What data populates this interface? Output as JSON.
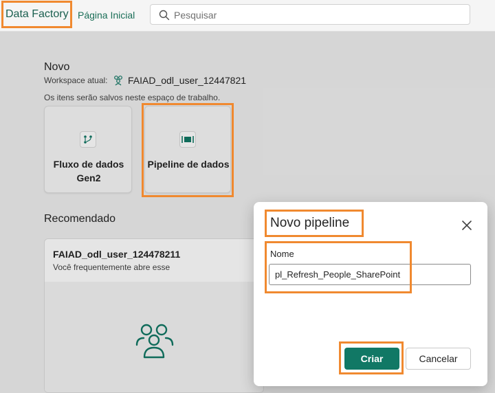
{
  "header": {
    "brand": "Data Factory",
    "home_link": "Página Inicial",
    "search_placeholder": "Pesquisar"
  },
  "new_section": {
    "title": "Novo",
    "workspace_label": "Workspace atual:",
    "workspace_name": "FAIAD_odl_user_12447821",
    "save_note": "Os itens serão salvos neste espaço de trabalho.",
    "items": [
      {
        "label_line1": "Fluxo de dados",
        "label_line2": "Gen2",
        "icon": "dataflow-icon"
      },
      {
        "label_line1": "Pipeline de dados",
        "label_line2": "",
        "icon": "pipeline-icon"
      }
    ]
  },
  "recommended": {
    "title": "Recomendado",
    "card_title": "FAIAD_odl_user_124478211",
    "card_subtitle": "Você frequentemente abre esse",
    "card_icon": "workspace-people-icon"
  },
  "dialog": {
    "title": "Novo pipeline",
    "field_label": "Nome",
    "field_value": "pl_Refresh_People_SharePoint",
    "create_label": "Criar",
    "cancel_label": "Cancelar"
  },
  "colors": {
    "accent": "#117865",
    "highlight": "#f0892f"
  }
}
